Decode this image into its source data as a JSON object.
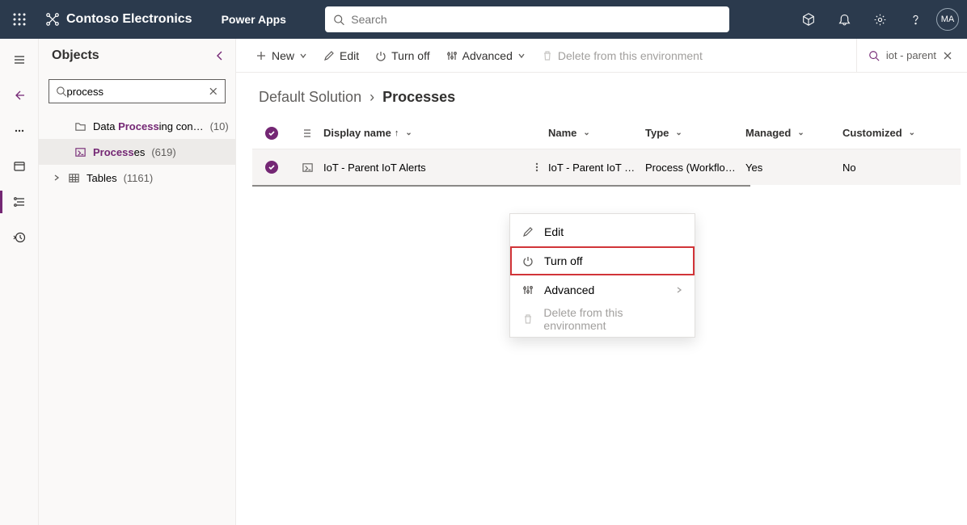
{
  "header": {
    "brand": "Contoso Electronics",
    "app": "Power Apps",
    "search_placeholder": "Search",
    "avatar_initials": "MA"
  },
  "panel": {
    "title": "Objects",
    "search_value": "process",
    "tree": [
      {
        "icon": "folder",
        "label_pre": "Data ",
        "label_bold": "Process",
        "label_post": "ing con…",
        "count": "(10)"
      },
      {
        "icon": "process",
        "label_pre": "",
        "label_bold": "Process",
        "label_post": "es",
        "count": "(619)",
        "selected": true
      },
      {
        "icon": "table",
        "label_pre": "Tables",
        "label_bold": "",
        "label_post": "",
        "count": "(1161)",
        "caret": true
      }
    ]
  },
  "commands": {
    "new": "New",
    "edit": "Edit",
    "turnoff": "Turn off",
    "advanced": "Advanced",
    "delete": "Delete from this environment",
    "filter_value": "iot - parent"
  },
  "breadcrumb": {
    "root": "Default Solution",
    "sep": "›",
    "current": "Processes"
  },
  "grid": {
    "columns": {
      "display": "Display name",
      "name": "Name",
      "type": "Type",
      "managed": "Managed",
      "custom": "Customized"
    },
    "row": {
      "display": "IoT - Parent IoT Alerts",
      "name": "IoT - Parent IoT …",
      "type": "Process (Workflo…",
      "managed": "Yes",
      "custom": "No"
    }
  },
  "menu": {
    "edit": "Edit",
    "turnoff": "Turn off",
    "advanced": "Advanced",
    "delete": "Delete from this environment"
  }
}
